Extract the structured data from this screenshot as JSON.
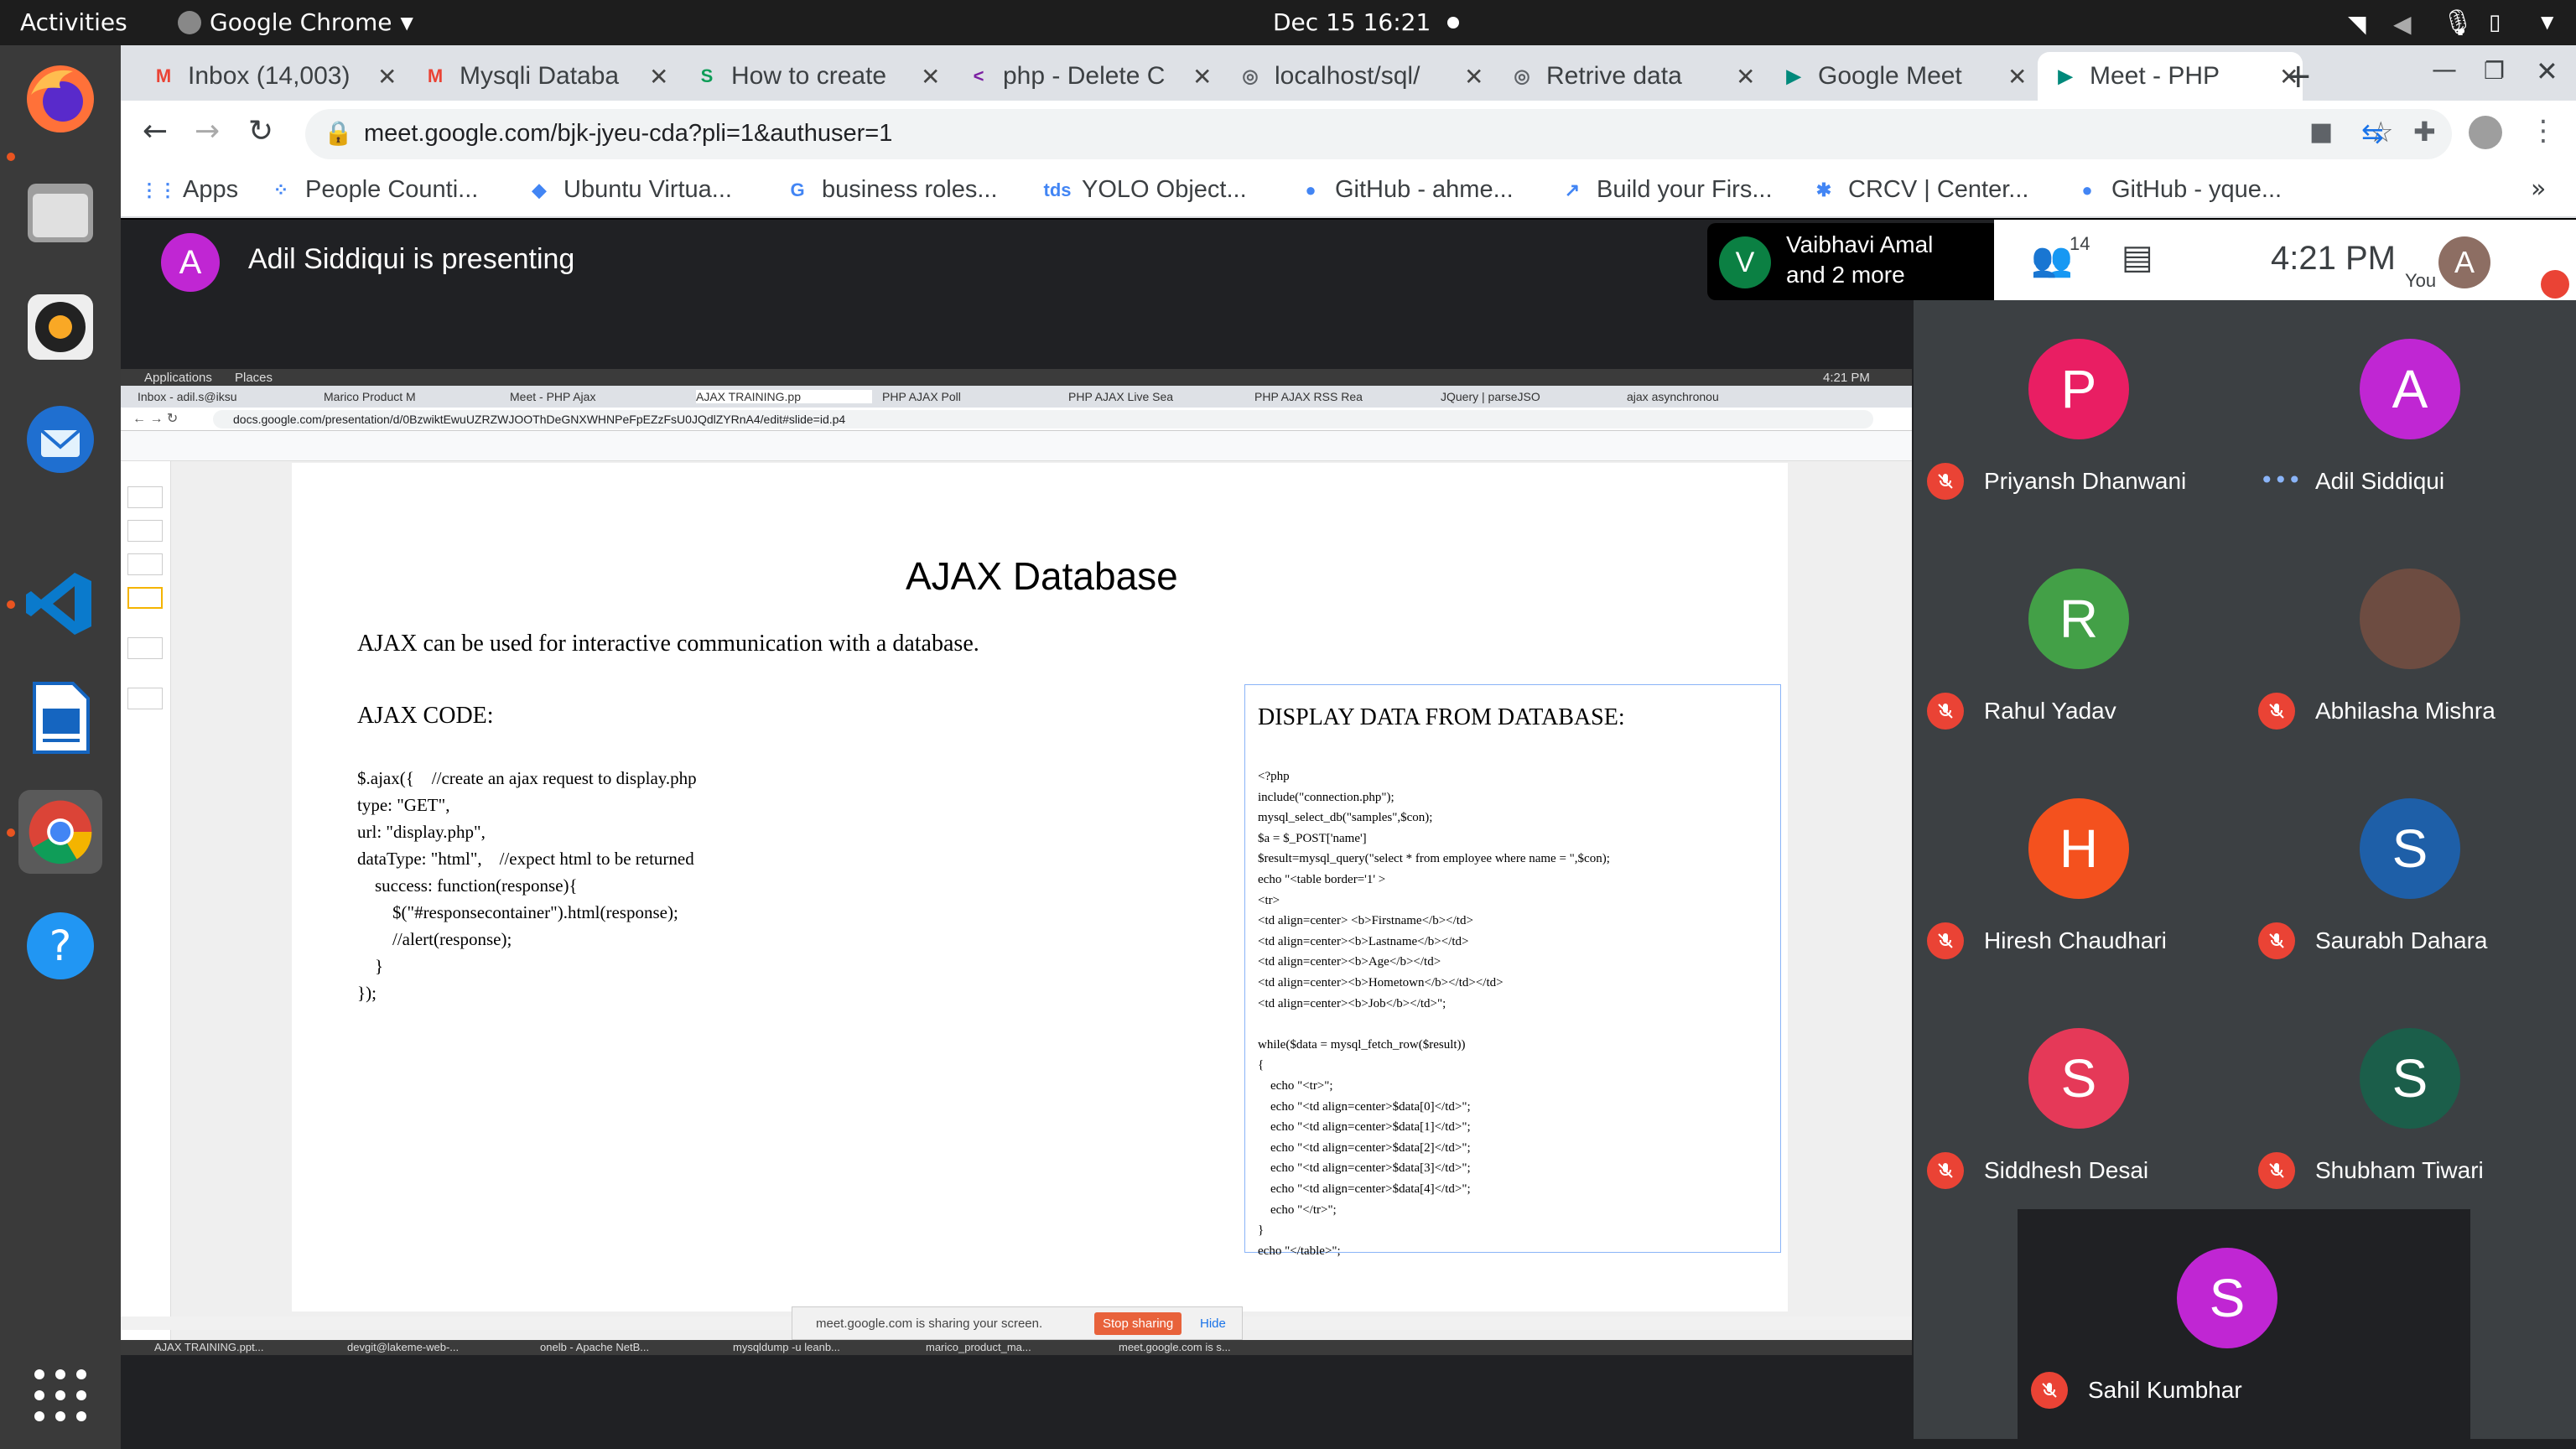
{
  "topbar": {
    "activities": "Activities",
    "app": "Google Chrome",
    "clock": "Dec 15  16:21"
  },
  "dock": {
    "items": [
      "firefox-icon",
      "files-icon",
      "rhythmbox-icon",
      "thunderbird-icon",
      "vscode-icon",
      "libreoffice-impress-icon",
      "chrome-icon",
      "help-icon",
      "apps-grid-icon"
    ]
  },
  "tabs": [
    {
      "label": "Inbox (14,003)",
      "fav": "M",
      "color": "#ea4335"
    },
    {
      "label": "Mysqli Databa",
      "fav": "M",
      "color": "#ea4335"
    },
    {
      "label": "How to create",
      "fav": "S",
      "color": "#0f9d58"
    },
    {
      "label": "php - Delete C",
      "fav": "<",
      "color": "#7b1fa2"
    },
    {
      "label": "localhost/sql/",
      "fav": "◎",
      "color": "#5f6368"
    },
    {
      "label": "Retrive data",
      "fav": "◎",
      "color": "#5f6368"
    },
    {
      "label": "Google Meet",
      "fav": "▶",
      "color": "#00897b"
    },
    {
      "label": "Meet - PHP",
      "fav": "▶",
      "color": "#00897b"
    }
  ],
  "address": {
    "url": "meet.google.com/bjk-jyeu-cda?pli=1&authuser=1"
  },
  "bookmarks": [
    {
      "label": "Apps",
      "ic": "⋮⋮"
    },
    {
      "label": "People Counti...",
      "ic": "⁘"
    },
    {
      "label": "Ubuntu Virtua...",
      "ic": "◆"
    },
    {
      "label": "business roles...",
      "ic": "G"
    },
    {
      "label": "YOLO Object...",
      "ic": "tds"
    },
    {
      "label": "GitHub - ahme...",
      "ic": "●"
    },
    {
      "label": "Build your Firs...",
      "ic": "↗"
    },
    {
      "label": "CRCV | Center...",
      "ic": "✱"
    },
    {
      "label": "GitHub - yque...",
      "ic": "●"
    }
  ],
  "meet": {
    "presenter_initial": "A",
    "presenting_text": "Adil Siddiqui is presenting",
    "pinned_initial": "V",
    "pinned_line1": "Vaibhavi Amal",
    "pinned_line2": "and 2 more",
    "people_count": "14",
    "time": "4:21 PM",
    "you_label": "You",
    "you_initial": "A",
    "participants": [
      {
        "name": "Priyansh Dhanwani",
        "initial": "P",
        "color": "#e91e63",
        "muted": true
      },
      {
        "name": "Adil Siddiqui",
        "initial": "A",
        "color": "#c026d3",
        "muted": false
      },
      {
        "name": "Rahul Yadav",
        "initial": "R",
        "color": "#43a047",
        "muted": true
      },
      {
        "name": "Abhilasha Mishra",
        "initial": "",
        "color": "#6d4c41",
        "muted": true
      },
      {
        "name": "Hiresh Chaudhari",
        "initial": "H",
        "color": "#f4511e",
        "muted": true
      },
      {
        "name": "Saurabh Dahara",
        "initial": "S",
        "color": "#1e5fa8",
        "muted": true
      },
      {
        "name": "Siddhesh Desai",
        "initial": "S",
        "color": "#e53958",
        "muted": true
      },
      {
        "name": "Shubham Tiwari",
        "initial": "S",
        "color": "#1b5e4a",
        "muted": true
      },
      {
        "name": "Sahil Kumbhar",
        "initial": "S",
        "color": "#c026d3",
        "muted": true
      }
    ]
  },
  "share": {
    "gnome": {
      "applications": "Applications",
      "places": "Places",
      "clock": "4:21 PM"
    },
    "tabs": [
      "Inbox - adil.s@iksu",
      "Marico Product M",
      "Meet - PHP Ajax",
      "AJAX TRAINING.pp",
      "PHP AJAX Poll",
      "PHP AJAX Live Sea",
      "PHP AJAX RSS Rea",
      "JQuery | parseJSO",
      "ajax asynchronou"
    ],
    "url": "docs.google.com/presentation/d/0BzwiktEwuUZRZWJOOThDeGNXWHNPeFpEZzFsU0JQdlZYRnA4/edit#slide=id.p4",
    "slide_title": "AJAX Database",
    "slide_intro": "AJAX can be used for interactive communication with a database.",
    "code_heading": "AJAX CODE:",
    "code_lines": [
      "$.ajax({    //create an ajax request to display.php",
      "type: \"GET\",",
      "url: \"display.php\",",
      "dataType: \"html\",    //expect html to be returned",
      "    success: function(response){",
      "        $(\"#responsecontainer\").html(response);",
      "        //alert(response);",
      "    }",
      "});"
    ],
    "db_heading": "DISPLAY DATA FROM DATABASE:",
    "db_lines": [
      "<?php",
      "include(\"connection.php\");",
      "mysql_select_db(\"samples\",$con);",
      "$a = $_POST['name']",
      "$result=mysql_query(\"select * from employee where name = \",$con);",
      "echo \"<table border='1' >",
      "<tr>",
      "<td align=center> <b>Firstname</b></td>",
      "<td align=center><b>Lastname</b></td>",
      "<td align=center><b>Age</b></td>",
      "<td align=center><b>Hometown</b></td></td>",
      "<td align=center><b>Job</b></td>\";",
      "",
      "while($data = mysql_fetch_row($result))",
      "{",
      "    echo \"<tr>\";",
      "    echo \"<td align=center>$data[0]</td>\";",
      "    echo \"<td align=center>$data[1]</td>\";",
      "    echo \"<td align=center>$data[2]</td>\";",
      "    echo \"<td align=center>$data[3]</td>\";",
      "    echo \"<td align=center>$data[4]</td>\";",
      "    echo \"</tr>\";",
      "}",
      "echo \"</table>\";"
    ],
    "sharing_text": "meet.google.com is sharing your screen.",
    "stop_sharing": "Stop sharing",
    "hide": "Hide",
    "taskbar": [
      "AJAX TRAINING.ppt...",
      "devgit@lakeme-web-...",
      "onelb - Apache NetB...",
      "mysqldump -u leanb...",
      "marico_product_ma...",
      "meet.google.com is s..."
    ]
  }
}
